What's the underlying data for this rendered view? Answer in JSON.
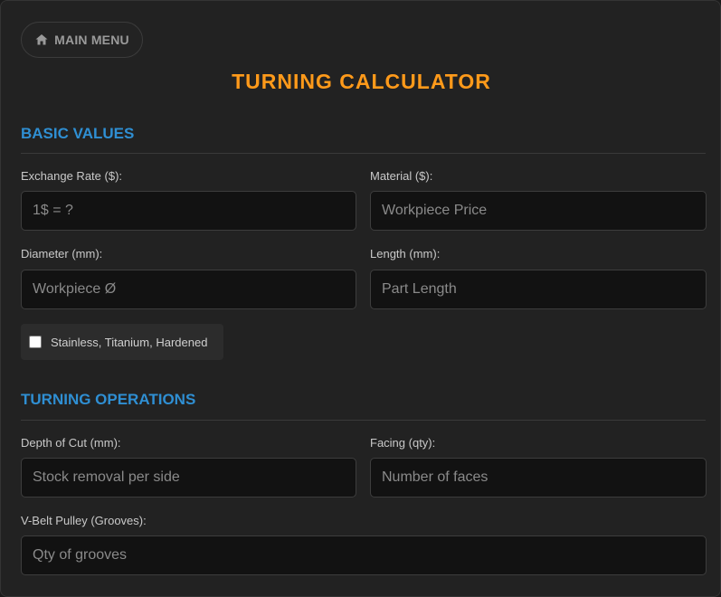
{
  "header": {
    "menu_button_label": "MAIN MENU",
    "menu_icon": "home-icon",
    "title": "TURNING CALCULATOR"
  },
  "basic_values": {
    "heading": "BASIC VALUES",
    "exchange_rate": {
      "label": "Exchange Rate ($):",
      "placeholder": "1$ = ?",
      "value": ""
    },
    "material": {
      "label": "Material ($):",
      "placeholder": "Workpiece Price",
      "value": ""
    },
    "diameter": {
      "label": "Diameter (mm):",
      "placeholder": "Workpiece Ø",
      "value": ""
    },
    "length": {
      "label": "Length (mm):",
      "placeholder": "Part Length",
      "value": ""
    },
    "hard_material": {
      "label": "Stainless, Titanium, Hardened",
      "checked": false
    }
  },
  "turning_operations": {
    "heading": "TURNING OPERATIONS",
    "depth_of_cut": {
      "label": "Depth of Cut (mm):",
      "placeholder": "Stock removal per side",
      "value": ""
    },
    "facing": {
      "label": "Facing (qty):",
      "placeholder": "Number of faces",
      "value": ""
    },
    "vbelt_pulley": {
      "label": "V-Belt Pulley (Grooves):",
      "placeholder": "Qty of grooves",
      "value": ""
    }
  },
  "colors": {
    "accent_title": "#ff9a1a",
    "section_heading": "#2f8fd3",
    "background": "#222222",
    "input_background": "#121212"
  }
}
